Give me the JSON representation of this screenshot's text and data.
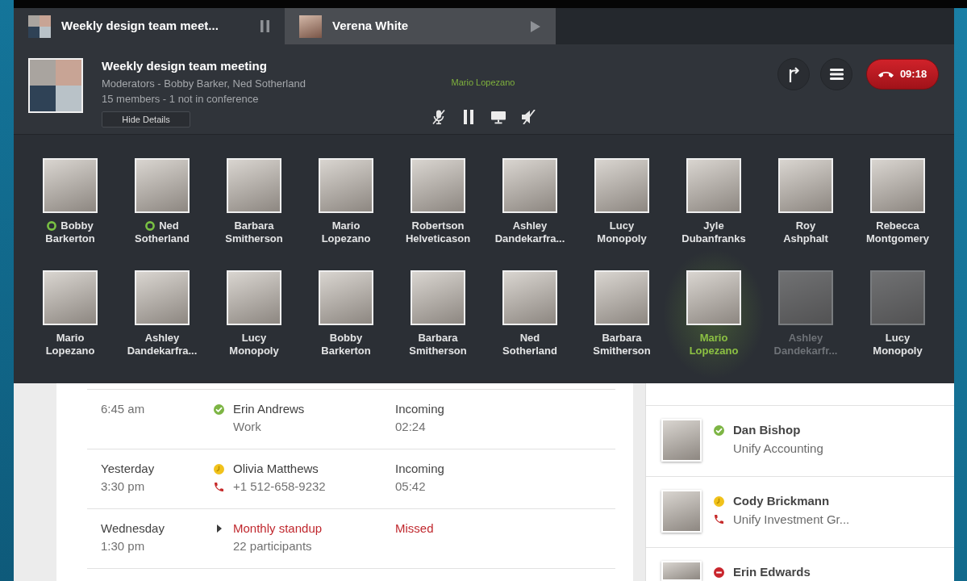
{
  "tabs": [
    {
      "title": "Weekly design team meet...",
      "kind": "group",
      "selected": true,
      "on_hold": false
    },
    {
      "title": "Verena White",
      "kind": "single",
      "selected": false,
      "on_hold": true
    }
  ],
  "conference": {
    "title": "Weekly design team meeting",
    "moderators": "Moderators - Bobby Barker, Ned Sotherland",
    "members": "15 members - 1 not in conference",
    "details_button": "Hide Details",
    "active_speaker": "Mario Lopezano",
    "call_timer": "09:18"
  },
  "participants": [
    {
      "first": "Bobby",
      "last": "Barkerton",
      "moderator": true,
      "speaking": false,
      "photo_dimmed": false,
      "name_dimmed": false
    },
    {
      "first": "Ned",
      "last": "Sotherland",
      "moderator": true,
      "speaking": false,
      "photo_dimmed": false,
      "name_dimmed": false
    },
    {
      "first": "Barbara",
      "last": "Smitherson",
      "moderator": false,
      "speaking": false,
      "photo_dimmed": false,
      "name_dimmed": false
    },
    {
      "first": "Mario",
      "last": "Lopezano",
      "moderator": false,
      "speaking": false,
      "photo_dimmed": false,
      "name_dimmed": false
    },
    {
      "first": "Robertson",
      "last": "Helveticason",
      "moderator": false,
      "speaking": false,
      "photo_dimmed": false,
      "name_dimmed": false
    },
    {
      "first": "Ashley",
      "last": "Dandekarfra...",
      "moderator": false,
      "speaking": false,
      "photo_dimmed": false,
      "name_dimmed": false
    },
    {
      "first": "Lucy",
      "last": "Monopoly",
      "moderator": false,
      "speaking": false,
      "photo_dimmed": false,
      "name_dimmed": false
    },
    {
      "first": "Jyle",
      "last": "Dubanfranks",
      "moderator": false,
      "speaking": false,
      "photo_dimmed": false,
      "name_dimmed": false
    },
    {
      "first": "Roy",
      "last": "Ashphalt",
      "moderator": false,
      "speaking": false,
      "photo_dimmed": false,
      "name_dimmed": false
    },
    {
      "first": "Rebecca",
      "last": "Montgomery",
      "moderator": false,
      "speaking": false,
      "photo_dimmed": false,
      "name_dimmed": false
    },
    {
      "first": "Mario",
      "last": "Lopezano",
      "moderator": false,
      "speaking": false,
      "photo_dimmed": false,
      "name_dimmed": false
    },
    {
      "first": "Ashley",
      "last": "Dandekarfra...",
      "moderator": false,
      "speaking": false,
      "photo_dimmed": false,
      "name_dimmed": false
    },
    {
      "first": "Lucy",
      "last": "Monopoly",
      "moderator": false,
      "speaking": false,
      "photo_dimmed": false,
      "name_dimmed": false
    },
    {
      "first": "Bobby",
      "last": "Barkerton",
      "moderator": false,
      "speaking": false,
      "photo_dimmed": false,
      "name_dimmed": false
    },
    {
      "first": "Barbara",
      "last": "Smitherson",
      "moderator": false,
      "speaking": false,
      "photo_dimmed": false,
      "name_dimmed": false
    },
    {
      "first": "Ned",
      "last": "Sotherland",
      "moderator": false,
      "speaking": false,
      "photo_dimmed": false,
      "name_dimmed": false
    },
    {
      "first": "Barbara",
      "last": "Smitherson",
      "moderator": false,
      "speaking": false,
      "photo_dimmed": false,
      "name_dimmed": false
    },
    {
      "first": "Mario",
      "last": "Lopezano",
      "moderator": false,
      "speaking": true,
      "photo_dimmed": false,
      "name_dimmed": false
    },
    {
      "first": "Ashley",
      "last": "Dandekarfr...",
      "moderator": false,
      "speaking": false,
      "photo_dimmed": true,
      "name_dimmed": true
    },
    {
      "first": "Lucy",
      "last": "Monopoly",
      "moderator": false,
      "speaking": false,
      "photo_dimmed": true,
      "name_dimmed": false
    }
  ],
  "calls": [
    {
      "kind": "available",
      "time": "6:45 am",
      "name": "Erin Andrews",
      "detail": "Work",
      "via_phone": false,
      "direction": "Incoming",
      "duration": "02:24",
      "missed": false
    },
    {
      "kind": "away",
      "day": "Yesterday",
      "time": "3:30 pm",
      "name": "Olivia Matthews",
      "detail": "+1 512-658-9232",
      "via_phone": true,
      "direction": "Incoming",
      "duration": "05:42",
      "missed": false
    },
    {
      "kind": "conference",
      "day": "Wednesday",
      "time": "1:30 pm",
      "name": "Monthly standup",
      "detail": "22 participants",
      "via_phone": false,
      "direction": "Missed",
      "missed": true
    }
  ],
  "contacts": [
    {
      "kind": "available",
      "name": "Dan Bishop",
      "company": "Unify Accounting",
      "via_phone": false
    },
    {
      "kind": "away",
      "name": "Cody Brickmann",
      "company": "Unify Investment Gr...",
      "via_phone": true
    },
    {
      "kind": "busy",
      "name": "Erin Edwards",
      "via_phone": false
    }
  ]
}
